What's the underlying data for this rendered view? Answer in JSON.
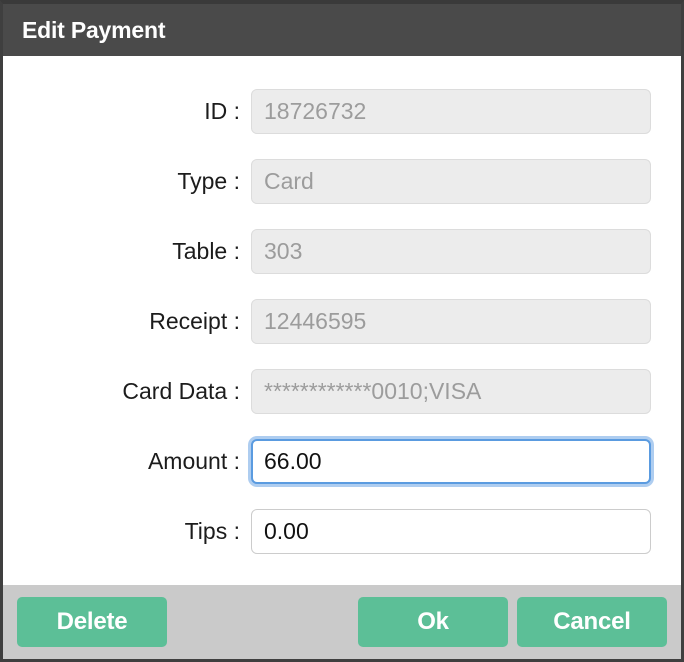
{
  "dialog": {
    "title": "Edit Payment",
    "accent_green": "#5cbf97",
    "focus_blue": "#5a9be0",
    "titlebar_color": "#4a4a4a",
    "footer_color": "#cacaca"
  },
  "fields": [
    {
      "label": "ID :",
      "value": "18726732",
      "state": "disabled"
    },
    {
      "label": "Type :",
      "value": "Card",
      "state": "disabled"
    },
    {
      "label": "Table :",
      "value": "303",
      "state": "disabled"
    },
    {
      "label": "Receipt :",
      "value": "12446595",
      "state": "disabled"
    },
    {
      "label": "Card Data :",
      "value": "************0010;VISA",
      "state": "disabled"
    },
    {
      "label": "Amount :",
      "value": "66.00",
      "state": "focused"
    },
    {
      "label": "Tips :",
      "value": "0.00",
      "state": "editable"
    }
  ],
  "footer": {
    "delete_label": "Delete",
    "ok_label": "Ok",
    "cancel_label": "Cancel"
  }
}
